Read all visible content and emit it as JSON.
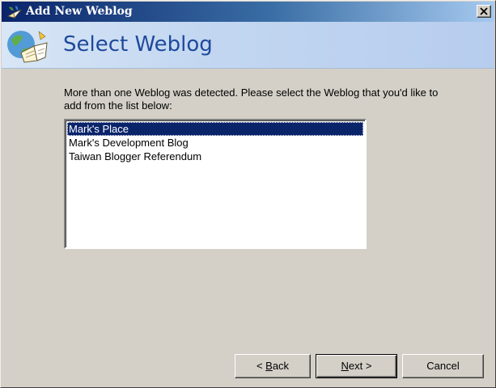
{
  "window": {
    "title": "Add New Weblog",
    "icon": "weblog-app-icon",
    "close_glyph": "×"
  },
  "header": {
    "title": "Select Weblog",
    "icon": "weblog-wizard-icon"
  },
  "instruction": {
    "text": "More than one Weblog was detected. Please select the Weblog that you'd like to add from the list below:"
  },
  "weblog_list": {
    "selected_index": 0,
    "items": [
      "Mark's Place",
      "Mark's Development Blog",
      "Taiwan Blogger Referendum"
    ]
  },
  "buttons": {
    "back": {
      "prefix": "< ",
      "mnemonic": "B",
      "rest": "ack"
    },
    "next": {
      "mnemonic": "N",
      "rest": "ext >"
    },
    "cancel": {
      "label": "Cancel"
    }
  },
  "colors": {
    "selection": "#0a246a",
    "title_text": "#1e4a9c",
    "dialog_bg": "#d4d0c8"
  }
}
